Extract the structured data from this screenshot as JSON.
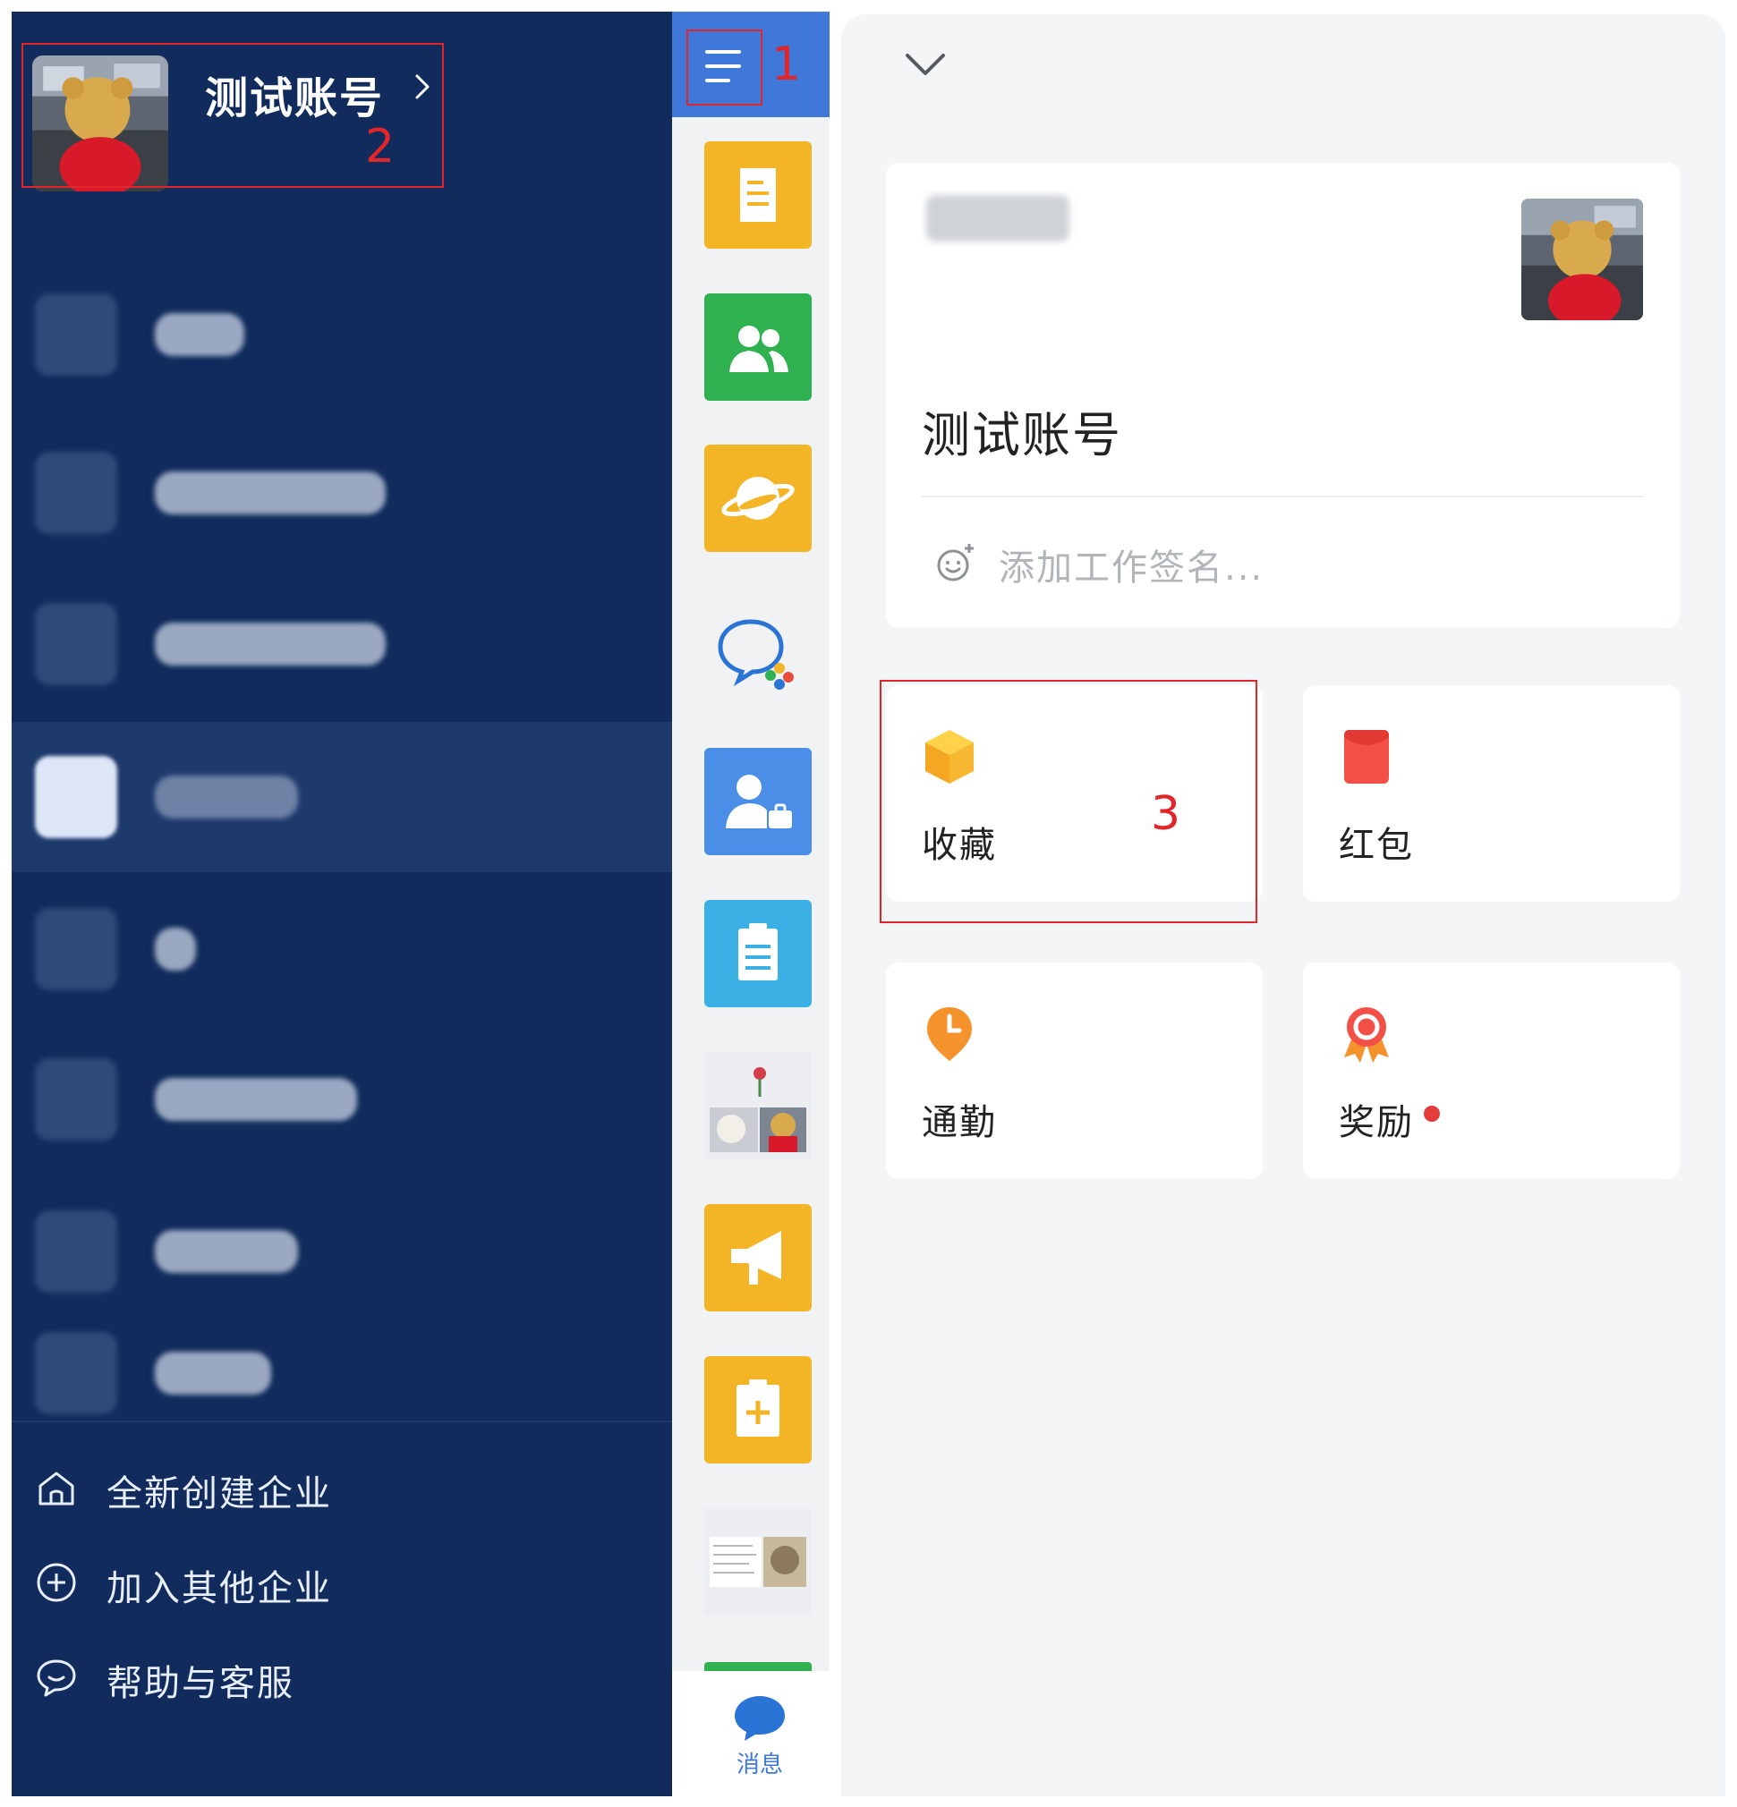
{
  "account": {
    "name": "测试账号"
  },
  "annotations": {
    "n1": "1",
    "n2": "2",
    "n3": "3"
  },
  "sidebar_menu": [
    {
      "icon": "home-icon",
      "label": "全新创建企业"
    },
    {
      "icon": "add-circle-icon",
      "label": "加入其他企业"
    },
    {
      "icon": "chat-bubble-icon",
      "label": "帮助与客服"
    }
  ],
  "rail": {
    "apps": [
      "document-icon",
      "contacts-icon",
      "planet-icon",
      "chat-multi-icon",
      "user-work-icon",
      "clipboard-icon",
      "photo-thumbnail",
      "megaphone-icon",
      "add-clipboard-icon",
      "photo-thumbnail"
    ],
    "bottom_label": "消息",
    "colors": {
      "header": "#3f78d8",
      "yellow": "#f3b525",
      "green": "#2fb150",
      "blue": "#4a8ee8",
      "cyan": "#3ab0e4"
    }
  },
  "profile": {
    "name": "测试账号",
    "signature_placeholder": "添加工作签名..."
  },
  "tiles": [
    {
      "key": "favorites",
      "label": "收藏",
      "icon": "box-icon"
    },
    {
      "key": "red_packet",
      "label": "红包",
      "icon": "red-envelope-icon"
    },
    {
      "key": "commute",
      "label": "通勤",
      "icon": "clock-pin-icon"
    },
    {
      "key": "rewards",
      "label": "奖励",
      "icon": "medal-icon",
      "badge_dot": true
    }
  ],
  "theme": {
    "sidebar_bg": "#112c5c",
    "highlight": "#e0262b",
    "panel_bg": "#f4f5f7"
  }
}
